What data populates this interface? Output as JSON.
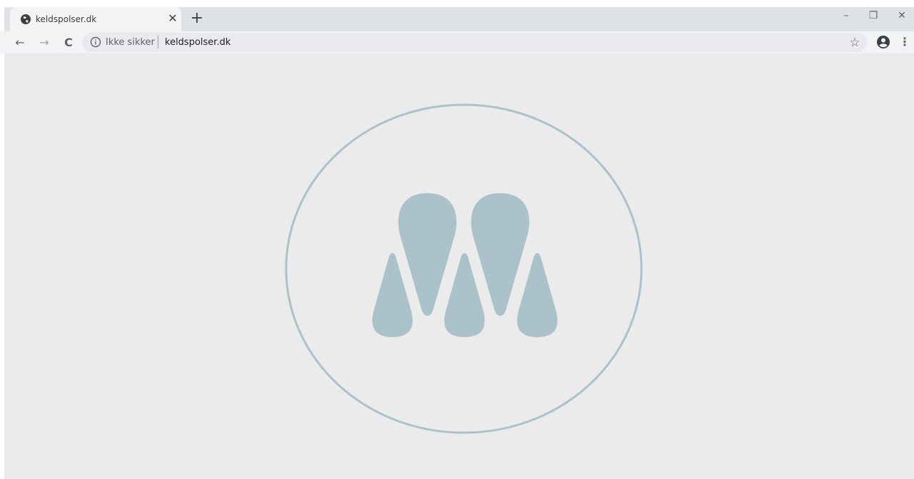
{
  "tab": {
    "title": "keldspolser.dk",
    "close_glyph": "✕",
    "favicon": "globe-icon"
  },
  "new_tab_glyph": "+",
  "window_controls": {
    "minimize": "–",
    "restore": "❐",
    "close": "✕"
  },
  "toolbar": {
    "back": "←",
    "forward": "→",
    "reload": "C",
    "security_label": "Ikke sikker",
    "url": "keldspolser.dk",
    "bookmark": "☆",
    "menu": "⋮"
  },
  "page": {
    "background": "#ebebeb",
    "logo_color": "#abc2ca",
    "logo": "drops-logo"
  }
}
